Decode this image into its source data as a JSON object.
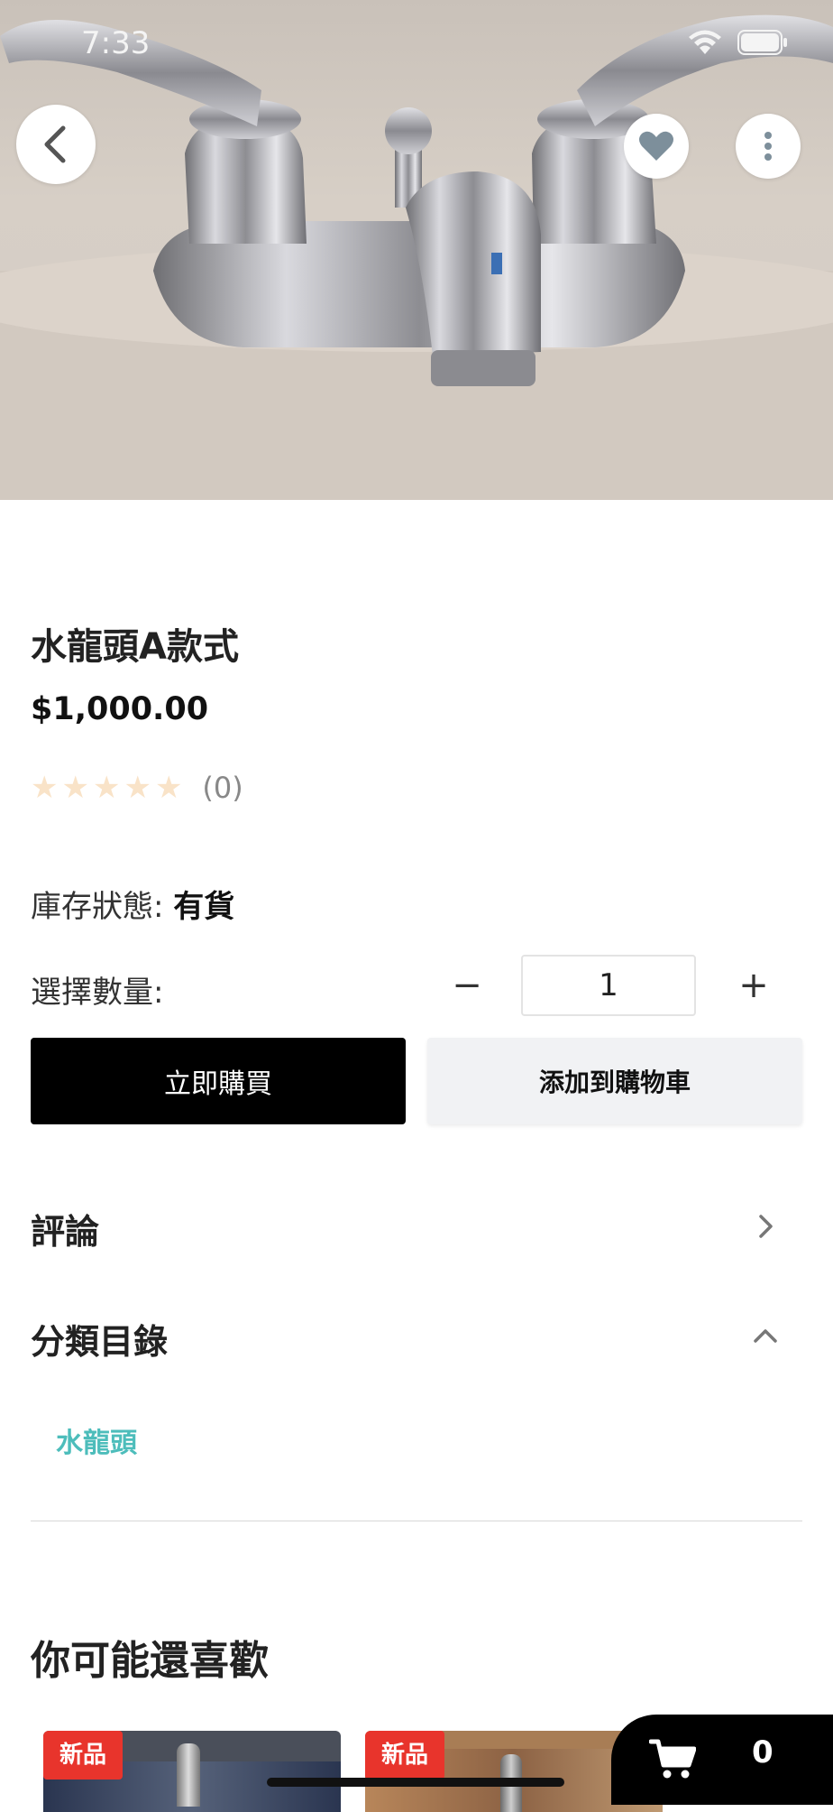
{
  "status_bar": {
    "time": "7:33"
  },
  "product": {
    "title": "水龍頭A款式",
    "price": "$1,000.00",
    "rating_count": "(0)",
    "rating_stars": 0,
    "stock_label": "庫存狀態:",
    "stock_value": "有貨",
    "quantity_label": "選擇數量:",
    "quantity_value": "1",
    "minus_label": "−",
    "plus_label": "+"
  },
  "actions": {
    "buy_now": "立即購買",
    "add_to_cart": "添加到購物車"
  },
  "sections": {
    "reviews": "評論",
    "categories": "分類目錄",
    "category_item": "水龍頭"
  },
  "recommendations": {
    "title": "你可能還喜歡",
    "cards": [
      {
        "badge": "新品"
      },
      {
        "badge": "新品"
      }
    ]
  },
  "cart": {
    "count": "0"
  },
  "colors": {
    "accent_teal": "#4dbdbb",
    "badge_red": "#e8342c",
    "star_empty": "#f9e3c8"
  }
}
